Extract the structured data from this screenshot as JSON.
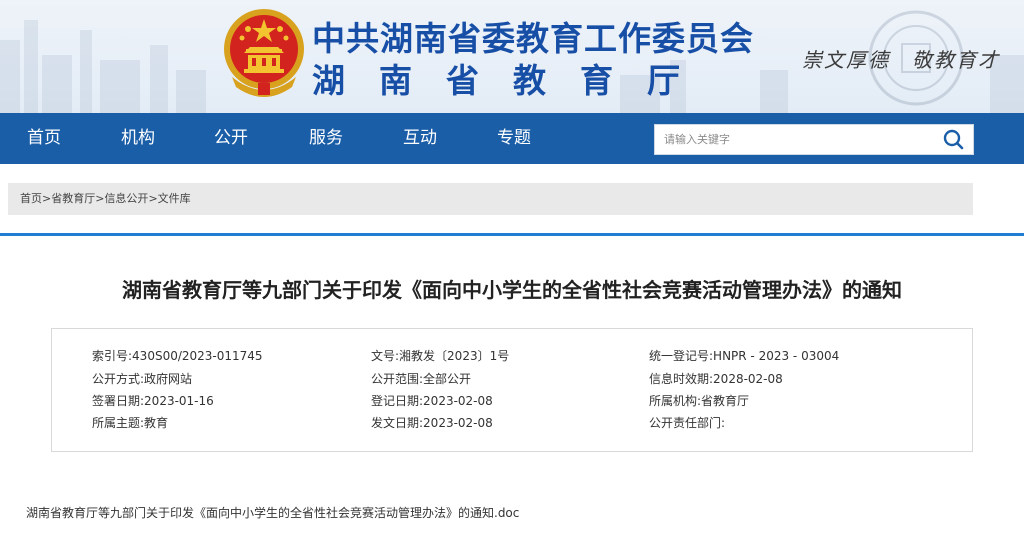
{
  "header": {
    "org_line1": "中共湖南省委教育工作委员会",
    "org_line2": "湖南省教育厅",
    "motto": "崇文厚德　敬教育才",
    "emblem": "national-emblem-icon",
    "brand_color": "#174ea6"
  },
  "nav": {
    "items": [
      "首页",
      "机构",
      "公开",
      "服务",
      "互动",
      "专题"
    ],
    "search_placeholder": "请输入关键字",
    "color": "#1a5ea8"
  },
  "breadcrumb": {
    "items": [
      "首页",
      "省教育厅",
      "信息公开",
      "文件库"
    ],
    "separator": ">"
  },
  "article": {
    "title": "湖南省教育厅等九部门关于印发《面向中小学生的全省性社会竞赛活动管理办法》的通知"
  },
  "meta": {
    "rows": [
      [
        {
          "label": "索引号:",
          "value": "430S00/2023-011745"
        },
        {
          "label": "文号:",
          "value": "湘教发〔2023〕1号"
        },
        {
          "label": "统一登记号:",
          "value": "HNPR - 2023 - 03004"
        }
      ],
      [
        {
          "label": "公开方式:",
          "value": "政府网站"
        },
        {
          "label": "公开范围:",
          "value": "全部公开"
        },
        {
          "label": "信息时效期:",
          "value": "2028-02-08"
        }
      ],
      [
        {
          "label": "签署日期:",
          "value": "2023-01-16"
        },
        {
          "label": "登记日期:",
          "value": "2023-02-08"
        },
        {
          "label": "所属机构:",
          "value": "省教育厅"
        }
      ],
      [
        {
          "label": "所属主题:",
          "value": "教育"
        },
        {
          "label": "发文日期:",
          "value": "2023-02-08"
        },
        {
          "label": "公开责任部门:",
          "value": ""
        }
      ]
    ]
  },
  "attachment": {
    "label": "湖南省教育厅等九部门关于印发《面向中小学生的全省性社会竞赛活动管理办法》的通知.doc"
  }
}
